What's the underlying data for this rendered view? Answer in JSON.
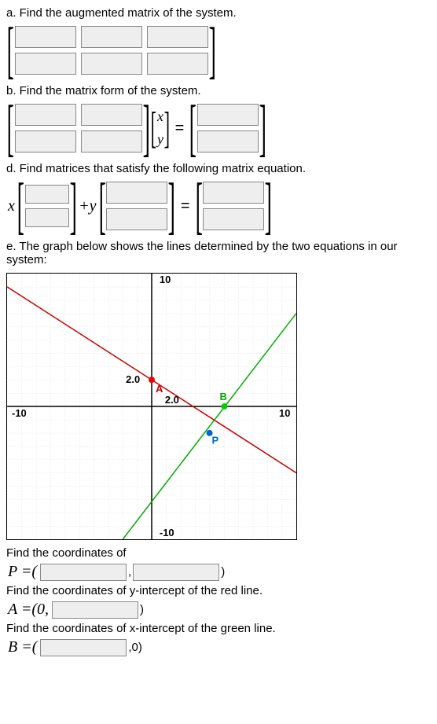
{
  "partA": {
    "prompt": "a. Find the augmented matrix of the system."
  },
  "partB": {
    "prompt": "b. Find the matrix form of the system.",
    "vec": {
      "top": "x",
      "bot": "y"
    },
    "eq": "="
  },
  "partD": {
    "prompt": "d. Find matrices that satisfy the following matrix equation.",
    "x": "x",
    "plus_y": "+y",
    "eq": "="
  },
  "partE": {
    "prompt": "e. The graph below shows the lines determined by the two equations in our system:",
    "find_coords": "Find the coordinates of",
    "P_eq": "P =(",
    "comma": ",",
    "close_paren": ")",
    "find_yint": "Find the coordinates of y-intercept of the red line.",
    "A_eq": "A =(0,",
    "find_xint": "Find the coordinates of x-intercept of the green line.",
    "B_eq": "B =(",
    "zero_close": ",0)"
  },
  "chart_data": {
    "type": "line",
    "xlim": [
      -10,
      10
    ],
    "ylim": [
      -10,
      10
    ],
    "xticks": [
      -10,
      10
    ],
    "yticks": [
      -10,
      10
    ],
    "annotations": [
      {
        "label": "A",
        "x": 0,
        "y": 2.0,
        "value_label": "2.0",
        "color": "red"
      },
      {
        "label": "B",
        "x": 5,
        "y": 0,
        "color": "green"
      },
      {
        "label": "P",
        "x": 4,
        "y": -2,
        "color": "blue"
      },
      {
        "label": "2.0",
        "x": 2.0,
        "y": 0
      }
    ],
    "series": [
      {
        "name": "red-line",
        "color": "#c00",
        "points": [
          [
            -10,
            9
          ],
          [
            10,
            -5
          ]
        ]
      },
      {
        "name": "green-line",
        "color": "#0a0",
        "points": [
          [
            -2,
            -10
          ],
          [
            10,
            7
          ]
        ]
      }
    ]
  }
}
